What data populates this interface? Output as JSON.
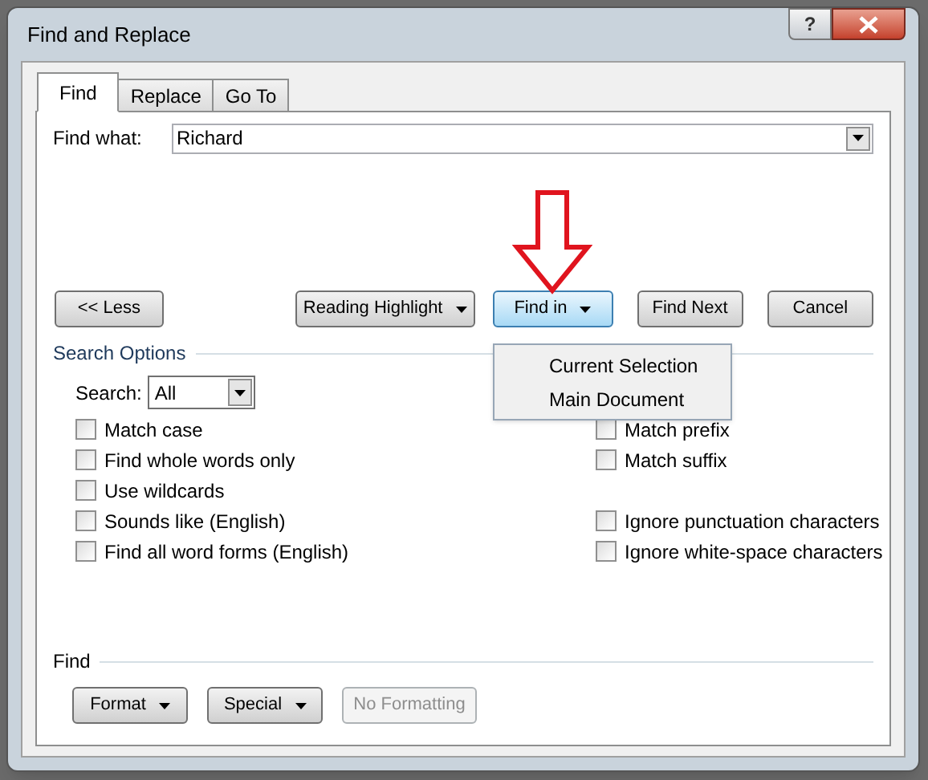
{
  "window": {
    "title": "Find and Replace",
    "help": "?"
  },
  "tabs": [
    {
      "label": "Find",
      "selected": true
    },
    {
      "label": "Replace",
      "selected": false
    },
    {
      "label": "Go To",
      "selected": false
    }
  ],
  "find_what": {
    "label": "Find what:",
    "value": "Richard"
  },
  "buttons": [
    {
      "label": "<< Less",
      "kind": "plain",
      "selected": false
    },
    {
      "label": "Reading Highlight",
      "kind": "dropdown",
      "selected": false
    },
    {
      "label": "Find in",
      "kind": "dropdown",
      "selected": true
    },
    {
      "label": "Find Next",
      "kind": "plain",
      "selected": false
    },
    {
      "label": "Cancel",
      "kind": "plain",
      "selected": false
    }
  ],
  "find_in_menu": {
    "items": [
      "Current Selection",
      "Main Document"
    ]
  },
  "search_options": {
    "title": "Search Options",
    "search_label": "Search:",
    "search_value": "All",
    "rows": [
      {
        "left": {
          "label": "Match case",
          "checked": false
        },
        "right": {
          "label": "Match prefix",
          "checked": false
        }
      },
      {
        "left": {
          "label": "Find whole words only",
          "checked": false
        },
        "right": {
          "label": "Match suffix",
          "checked": false
        }
      },
      {
        "left": {
          "label": "Use wildcards",
          "checked": false
        }
      },
      {
        "left": {
          "label": "Sounds like (English)",
          "checked": false
        },
        "right": {
          "label": "Ignore punctuation characters",
          "checked": false
        }
      },
      {
        "left": {
          "label": "Find all word forms (English)",
          "checked": false
        },
        "right": {
          "label": "Ignore white-space characters",
          "checked": false
        }
      }
    ]
  },
  "find_section": {
    "title": "Find",
    "buttons": [
      {
        "label": "Format",
        "kind": "dropdown",
        "disabled": false
      },
      {
        "label": "Special",
        "kind": "dropdown",
        "disabled": false
      },
      {
        "label": "No Formatting",
        "kind": "plain",
        "disabled": true
      }
    ]
  }
}
